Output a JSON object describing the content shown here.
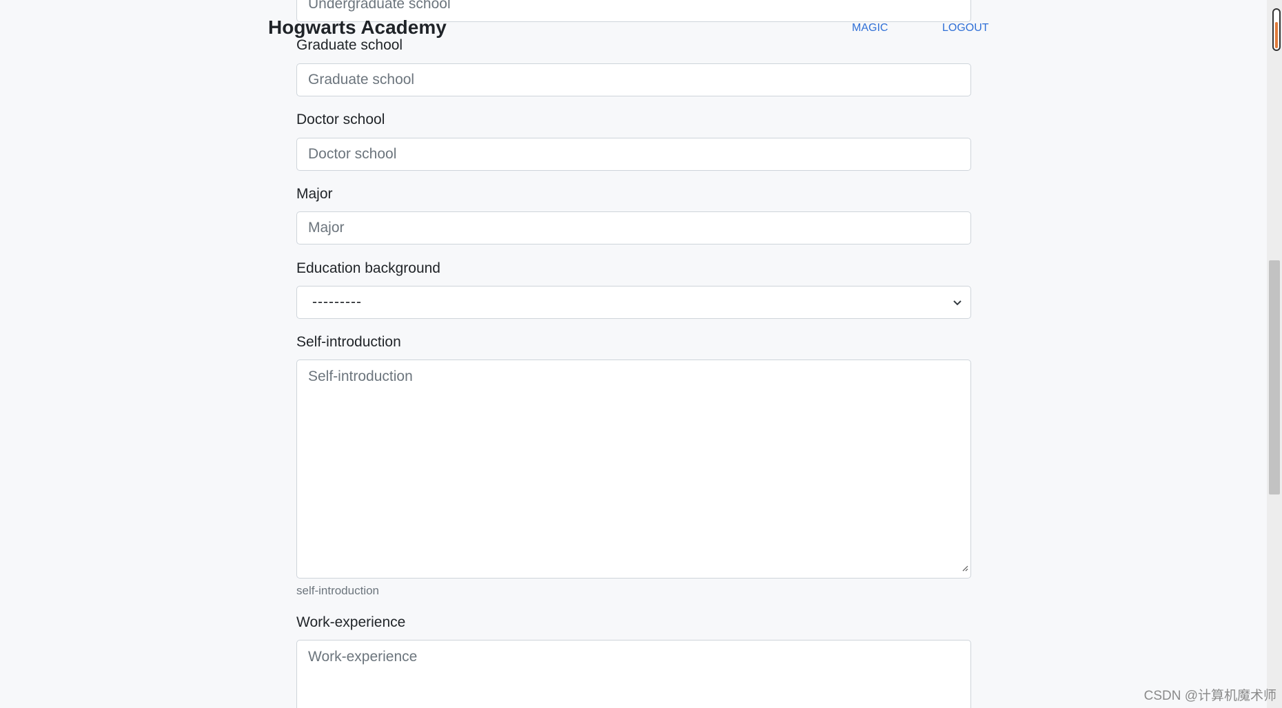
{
  "header": {
    "brand": "Hogwarts Academy",
    "nav": [
      {
        "label": "MAGIC"
      },
      {
        "label": "LOGOUT"
      }
    ],
    "link_color": "#2f6fd6"
  },
  "form": {
    "undergraduate": {
      "placeholder": "Undergraduate school"
    },
    "graduate": {
      "label": "Graduate school",
      "placeholder": "Graduate school"
    },
    "doctor": {
      "label": "Doctor school",
      "placeholder": "Doctor school"
    },
    "major": {
      "label": "Major",
      "placeholder": "Major"
    },
    "education": {
      "label": "Education background",
      "selected": "---------"
    },
    "self_intro": {
      "label": "Self-introduction",
      "placeholder": "Self-introduction",
      "help": "self-introduction"
    },
    "work": {
      "label": "Work-experience",
      "placeholder": "Work-experience"
    }
  },
  "icons": {
    "select_arrow": "chevron-down-icon",
    "resize": "resize-grip-icon"
  },
  "watermark": "CSDN @计算机魔术师"
}
